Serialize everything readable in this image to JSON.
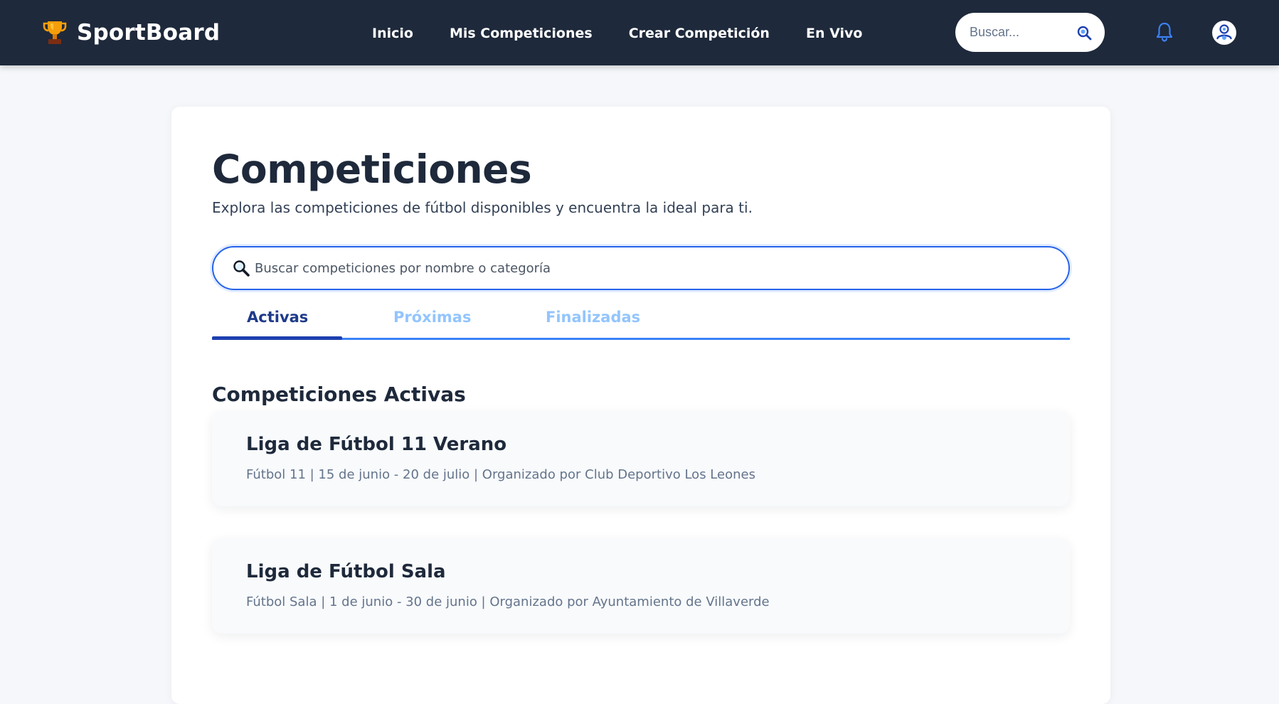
{
  "header": {
    "brand_name": "SportBoard",
    "brand_icon": "trophy-icon",
    "nav": [
      {
        "label": "Inicio"
      },
      {
        "label": "Mis Competiciones"
      },
      {
        "label": "Crear Competición"
      },
      {
        "label": "En Vivo"
      }
    ],
    "search_placeholder": "Buscar...",
    "search_icon": "search-icon",
    "notifications_icon": "bell-icon",
    "profile_icon": "user-avatar-icon"
  },
  "page": {
    "title": "Competiciones",
    "subtitle": "Explora las competiciones de fútbol disponibles y encuentra la ideal para ti.",
    "search_placeholder": "Buscar competiciones por nombre o categoría",
    "search_icon": "magnifier-icon"
  },
  "tabs": [
    {
      "label": "Activas",
      "active": true
    },
    {
      "label": "Próximas",
      "active": false
    },
    {
      "label": "Finalizadas",
      "active": false
    }
  ],
  "section": {
    "title": "Competiciones Activas",
    "competitions": [
      {
        "name": "Liga de Fútbol 11 Verano",
        "meta": "Fútbol 11 | 15 de junio - 20 de julio | Organizado por Club Deportivo Los Leones"
      },
      {
        "name": "Liga de Fútbol Sala",
        "meta": "Fútbol Sala | 1 de junio - 30 de junio | Organizado por Ayuntamiento de Villaverde"
      }
    ]
  },
  "colors": {
    "header_bg": "#1e293b",
    "accent": "#2563eb",
    "tab_active": "#1e3a8a",
    "tab_inactive": "#93c5fd",
    "page_bg": "#f5f7fa"
  }
}
